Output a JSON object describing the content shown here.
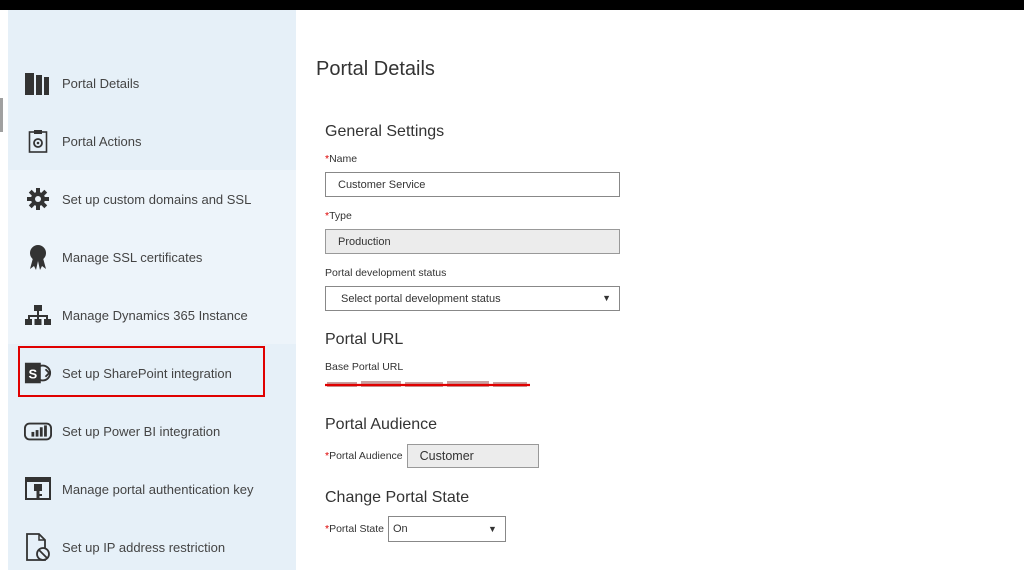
{
  "sidebar": {
    "items": [
      {
        "label": "Portal Details",
        "icon": "portal-details-icon"
      },
      {
        "label": "Portal Actions",
        "icon": "portal-actions-icon"
      },
      {
        "label": "Set up custom domains and SSL",
        "icon": "gear-icon"
      },
      {
        "label": "Manage SSL certificates",
        "icon": "certificate-icon"
      },
      {
        "label": "Manage Dynamics 365 Instance",
        "icon": "hierarchy-icon"
      },
      {
        "label": "Set up SharePoint integration",
        "icon": "sharepoint-icon"
      },
      {
        "label": "Set up Power BI integration",
        "icon": "power-bi-icon"
      },
      {
        "label": "Manage portal authentication key",
        "icon": "key-icon"
      },
      {
        "label": "Set up IP address restriction",
        "icon": "ip-restriction-icon"
      }
    ],
    "highlighted_item": "Set up SharePoint integration",
    "highlight_color": "#e00000"
  },
  "main": {
    "title": "Portal Details",
    "general_settings": {
      "title": "General Settings",
      "name_label": "Name",
      "name_value": "Customer Service",
      "type_label": "Type",
      "type_value": "Production",
      "dev_status_label": "Portal development status",
      "dev_status_value": "Select portal development status"
    },
    "portal_url": {
      "title": "Portal URL",
      "base_label": "Base Portal URL"
    },
    "portal_audience": {
      "title": "Portal Audience",
      "label": "Portal Audience",
      "value": "Customer"
    },
    "portal_state": {
      "title": "Change Portal State",
      "label": "Portal State",
      "value": "On"
    },
    "required_marker": "*"
  },
  "colors": {
    "sidebar_bg": "#e6f0f8",
    "required": "#d00000",
    "redaction": "#e00000"
  }
}
